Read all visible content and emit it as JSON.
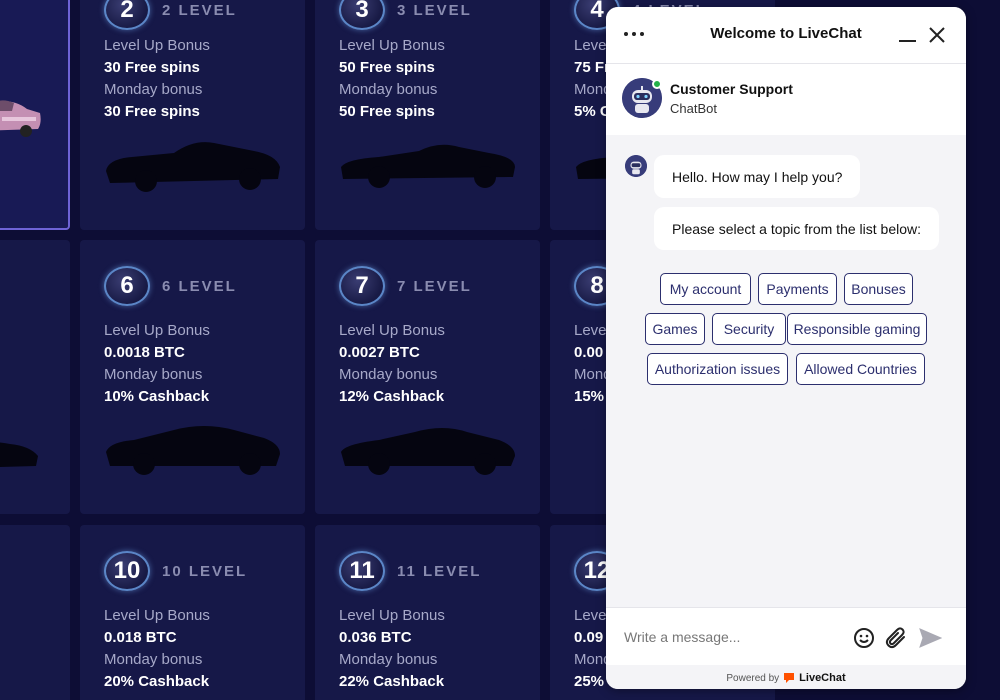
{
  "levels": {
    "row1": [
      {
        "number": "2",
        "level_text": "2 LEVEL",
        "bonus1_label": "Level Up Bonus",
        "bonus1_value": "30 Free spins",
        "bonus2_label": "Monday bonus",
        "bonus2_value": "30 Free spins"
      },
      {
        "number": "3",
        "level_text": "3 LEVEL",
        "bonus1_label": "Level Up Bonus",
        "bonus1_value": "50 Free spins",
        "bonus2_label": "Monday bonus",
        "bonus2_value": "50 Free spins"
      },
      {
        "number": "4",
        "level_text": "4 LEVEL",
        "bonus1_label": "Level",
        "bonus1_value": "75 Fr",
        "bonus2_label": "Mond",
        "bonus2_value": "5% C"
      }
    ],
    "row2": [
      {
        "number": "6",
        "level_text": "6 LEVEL",
        "bonus1_label": "Level Up Bonus",
        "bonus1_value": "0.0018 BTC",
        "bonus2_label": "Monday bonus",
        "bonus2_value": "10% Cashback"
      },
      {
        "number": "7",
        "level_text": "7 LEVEL",
        "bonus1_label": "Level Up Bonus",
        "bonus1_value": "0.0027 BTC",
        "bonus2_label": "Monday bonus",
        "bonus2_value": "12% Cashback"
      },
      {
        "number": "8",
        "level_text": "",
        "bonus1_label": "Level",
        "bonus1_value": "0.00",
        "bonus2_label": "Mond",
        "bonus2_value": "15%"
      }
    ],
    "row3": [
      {
        "number": "10",
        "level_text": "10 LEVEL",
        "bonus1_label": "Level Up Bonus",
        "bonus1_value": "0.018 BTC",
        "bonus2_label": "Monday bonus",
        "bonus2_value": "20% Cashback"
      },
      {
        "number": "11",
        "level_text": "11 LEVEL",
        "bonus1_label": "Level Up Bonus",
        "bonus1_value": "0.036 BTC",
        "bonus2_label": "Monday bonus",
        "bonus2_value": "22% Cashback"
      },
      {
        "number": "12",
        "level_text": "",
        "bonus1_label": "Level",
        "bonus1_value": "0.09",
        "bonus2_label": "Mond",
        "bonus2_value": "25%"
      }
    ]
  },
  "chat": {
    "title": "Welcome to LiveChat",
    "agent_name": "Customer Support",
    "agent_role": "ChatBot",
    "messages": [
      "Hello. How may I help you?",
      "Please select a topic from the list below:"
    ],
    "topics": [
      "My account",
      "Payments",
      "Bonuses",
      "Games",
      "Security",
      "Responsible gaming",
      "Authorization issues",
      "Allowed Countries"
    ],
    "input_placeholder": "Write a message...",
    "powered_by": "Powered by",
    "brand": "LiveChat",
    "colors": {
      "accent": "#2c2f6e",
      "online": "#25b04a",
      "brand_orange": "#ff5100"
    }
  },
  "icons": [
    "menu-dots-icon",
    "minimize-icon",
    "close-icon",
    "robot-avatar-icon",
    "emoji-icon",
    "attachment-icon",
    "send-icon",
    "livechat-logo-icon"
  ]
}
